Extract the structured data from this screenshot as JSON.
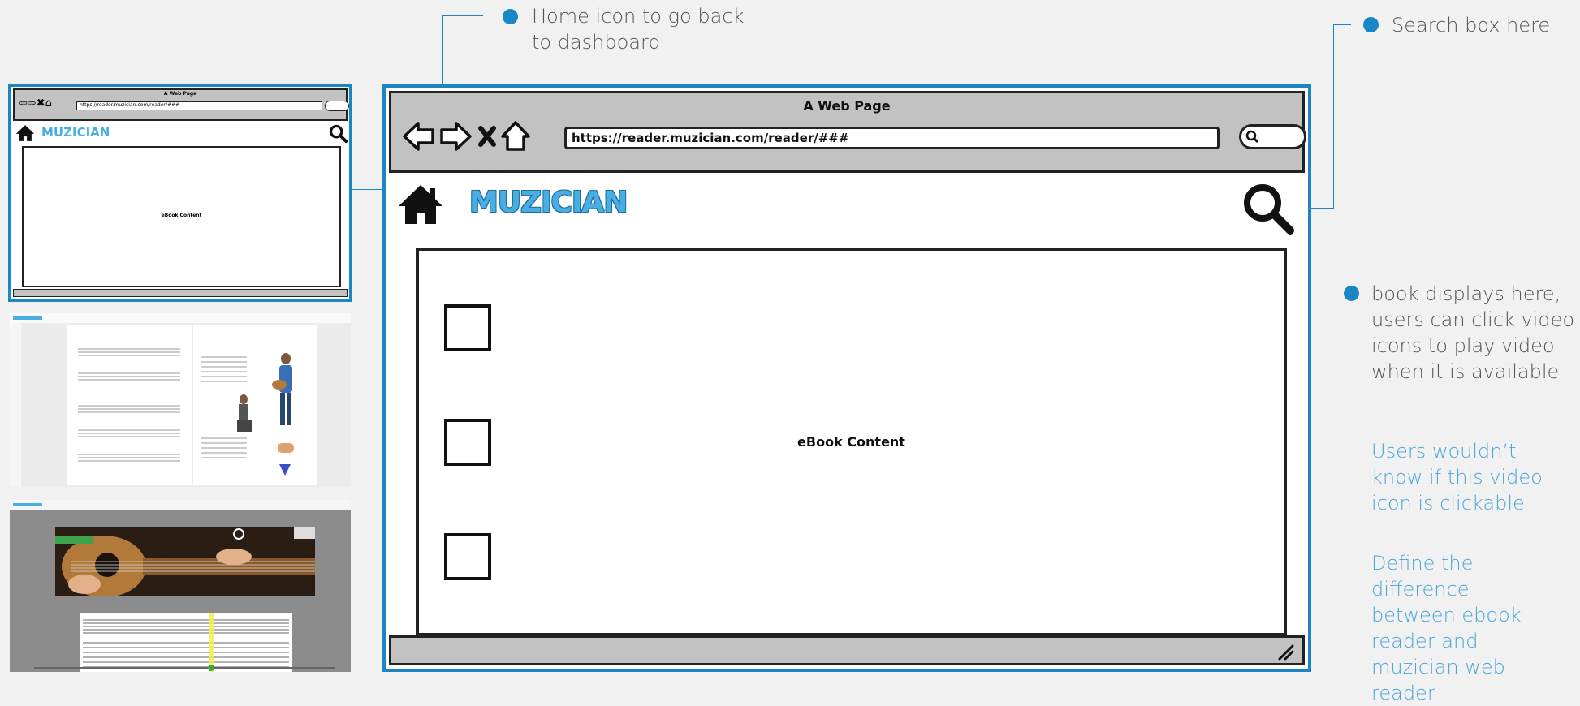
{
  "annotations": {
    "home": [
      "Home icon to go back",
      "to dashboard"
    ],
    "search": "Search box here",
    "book": [
      "book displays here,",
      "users can click video",
      "icons to play video",
      "when it is available"
    ],
    "clickable": [
      "Users wouldn’t",
      "know if this video",
      "icon is clickable"
    ],
    "define": [
      "Define the",
      "difference",
      "between ebook",
      "reader and",
      "muzician web",
      "reader"
    ]
  },
  "browser": {
    "page_title": "A Web Page",
    "url": "https://reader.muzician.com/reader/###",
    "nav_icons": [
      "back-arrow-icon",
      "forward-arrow-icon",
      "stop-x-icon",
      "home-outline-icon"
    ]
  },
  "app": {
    "logo": "MUZICIAN",
    "content_label": "eBook Content"
  },
  "thumbnail": {
    "page_title": "A Web Page",
    "url": "https://reader.muzician.com/reader/###",
    "logo": "MUZICIAN",
    "content_label": "eBook Content"
  },
  "colors": {
    "accent": "#1a86c4",
    "logo": "#4aaee3",
    "chrome": "#c2c2c2"
  }
}
